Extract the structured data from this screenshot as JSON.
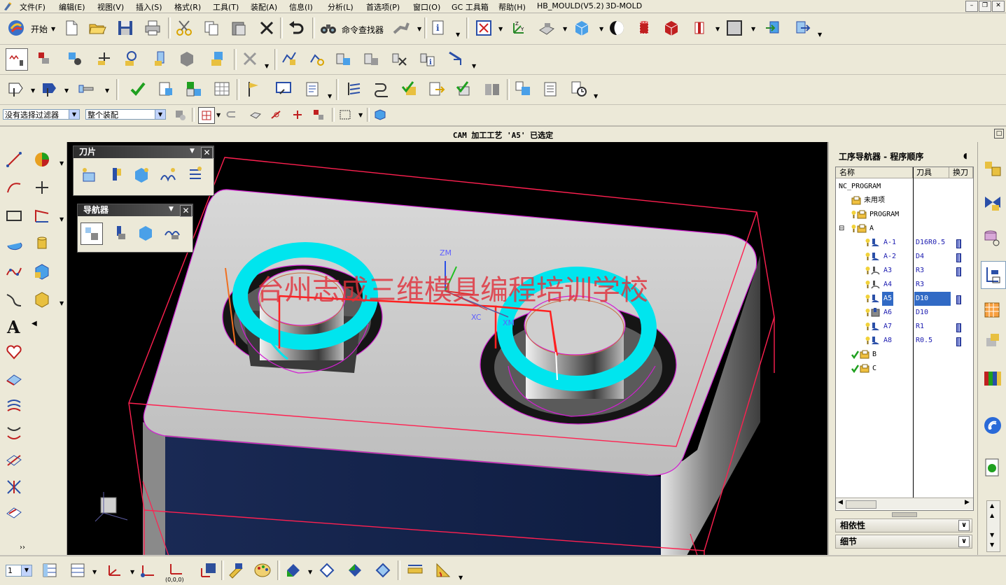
{
  "menu": {
    "items": [
      "文件(F)",
      "编辑(E)",
      "视图(V)",
      "插入(S)",
      "格式(R)",
      "工具(T)",
      "装配(A)",
      "信息(I)",
      "分析(L)",
      "首选项(P)",
      "窗口(O)",
      "GC 工具箱",
      "帮助(H)",
      "HB_MOULD(V5.2)",
      "3D-MOLD"
    ]
  },
  "toolbar": {
    "start_label": "开始",
    "command_finder_label": "命令查找器"
  },
  "selection": {
    "filter_value": "没有选择过滤器",
    "scope_value": "整个装配"
  },
  "cue_line": "CAM 加工工艺 'A5' 已选定",
  "viewport": {
    "watermark": "台州志成三维模具编程培训学校",
    "wcs": {
      "z": "ZM",
      "x": "XM",
      "xc": "XC"
    }
  },
  "palettes": {
    "insert": {
      "title": "刀片"
    },
    "navigator": {
      "title": "导航器"
    }
  },
  "operation_navigator": {
    "title": "工序导航器 - 程序顺序",
    "columns": [
      "名称",
      "刀具",
      "换刀"
    ],
    "rows": [
      {
        "name": "NC_PROGRAM",
        "tool": "",
        "change": false,
        "indent": 0,
        "icon": "none"
      },
      {
        "name": "未用项",
        "tool": "",
        "change": false,
        "indent": 1,
        "icon": "folder"
      },
      {
        "name": "PROGRAM",
        "tool": "",
        "change": false,
        "indent": 1,
        "icon": "bulb-folder"
      },
      {
        "name": "A",
        "tool": "",
        "change": false,
        "indent": 1,
        "icon": "bulb-folder",
        "expanded": true
      },
      {
        "name": "A-1",
        "tool": "D16R0.5",
        "change": true,
        "indent": 2,
        "icon": "bulb-cavity"
      },
      {
        "name": "A-2",
        "tool": "D4",
        "change": true,
        "indent": 2,
        "icon": "bulb-cavity"
      },
      {
        "name": "A3",
        "tool": "R3",
        "change": true,
        "indent": 2,
        "icon": "bulb-contour"
      },
      {
        "name": "A4",
        "tool": "R3",
        "change": false,
        "indent": 2,
        "icon": "bulb-contour"
      },
      {
        "name": "A5",
        "tool": "D10",
        "change": true,
        "indent": 2,
        "icon": "bulb-cavity",
        "selected": true
      },
      {
        "name": "A6",
        "tool": "D10",
        "change": false,
        "indent": 2,
        "icon": "bulb-planar"
      },
      {
        "name": "A7",
        "tool": "R1",
        "change": true,
        "indent": 2,
        "icon": "bulb-cavity"
      },
      {
        "name": "A8",
        "tool": "R0.5",
        "change": true,
        "indent": 2,
        "icon": "bulb-cavity"
      },
      {
        "name": "B",
        "tool": "",
        "change": false,
        "indent": 1,
        "icon": "check-folder"
      },
      {
        "name": "C",
        "tool": "",
        "change": false,
        "indent": 1,
        "icon": "check-folder"
      }
    ],
    "sections": [
      "相依性",
      "细节"
    ]
  },
  "bottom_bar": {
    "layer_value": "1",
    "origin_label": "(0,0,0)"
  },
  "colors": {
    "toolpath": "#00e5ee",
    "part_gray": "#c9c9c9",
    "boundary_magenta": "#d21fd2",
    "box_red": "#ff2040",
    "watermark": "#e0303a",
    "selection_blue": "#316ac5"
  }
}
